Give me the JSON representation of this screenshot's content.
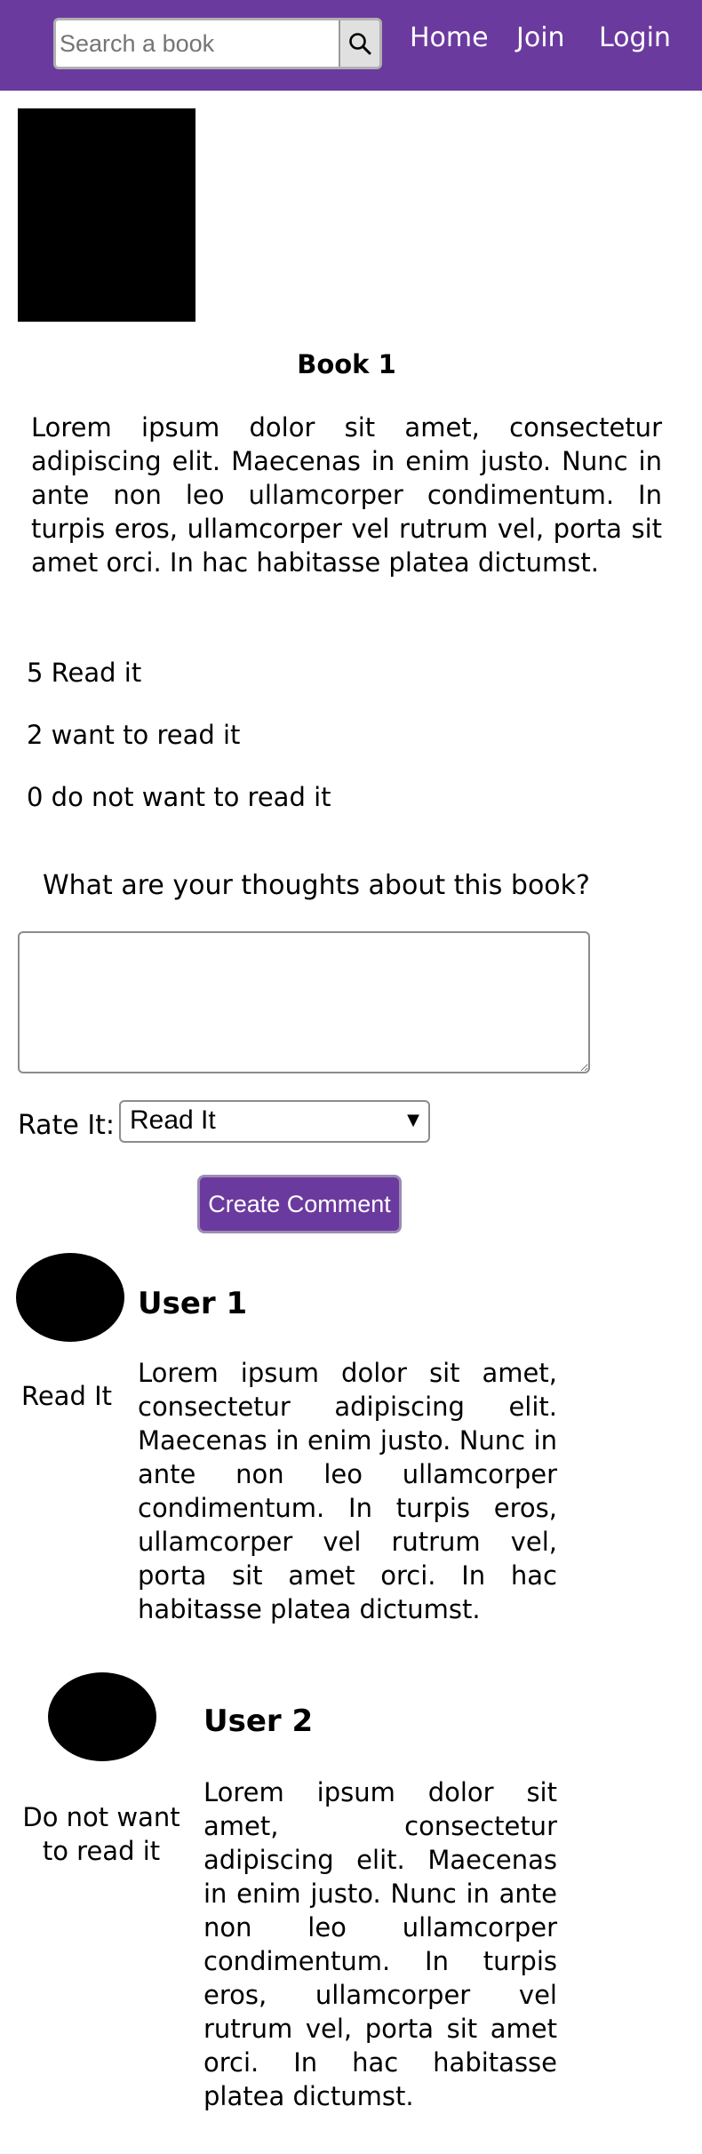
{
  "navbar": {
    "search_placeholder": "Search a book",
    "search_icon": "search-icon",
    "links": [
      "Home",
      "Join",
      "Login"
    ],
    "background_color": "#6b3a9e"
  },
  "book": {
    "title": "Book 1",
    "description": "Lorem ipsum dolor sit amet, consectetur adipiscing elit. Maecenas in enim justo. Nunc in ante non leo ullamcorper condimentum. In turpis eros, ullamcorper vel rutrum vel, porta sit amet orci. In hac habitasse platea dictumst."
  },
  "stats": {
    "read_it": "5 Read it",
    "want_to_read": "2 want to read it",
    "not_want_to_read": "0 do not want to read it"
  },
  "comment_form": {
    "prompt": "What are your thoughts about this book?",
    "comment_value": "",
    "rate_label": "Rate It:",
    "rate_selected": "Read It",
    "submit_label": "Create Comment",
    "button_color": "#6b3a9e"
  },
  "comments": [
    {
      "user": "User 1",
      "rating": "Read It",
      "text": "Lorem ipsum dolor sit amet, consectetur adipiscing elit. Maecenas in enim justo. Nunc in ante non leo ullamcorper condimentum. In turpis eros, ullamcorper vel rutrum vel, porta sit amet orci. In hac habitasse platea dictumst."
    },
    {
      "user": "User 2",
      "rating": "Do not want to read it",
      "text": "Lorem ipsum dolor sit amet, consectetur adipiscing elit. Maecenas in enim justo. Nunc in ante non leo ullamcorper condimentum. In turpis eros, ullamcorper vel rutrum vel, porta sit amet orci. In hac habitasse platea dictumst."
    }
  ]
}
